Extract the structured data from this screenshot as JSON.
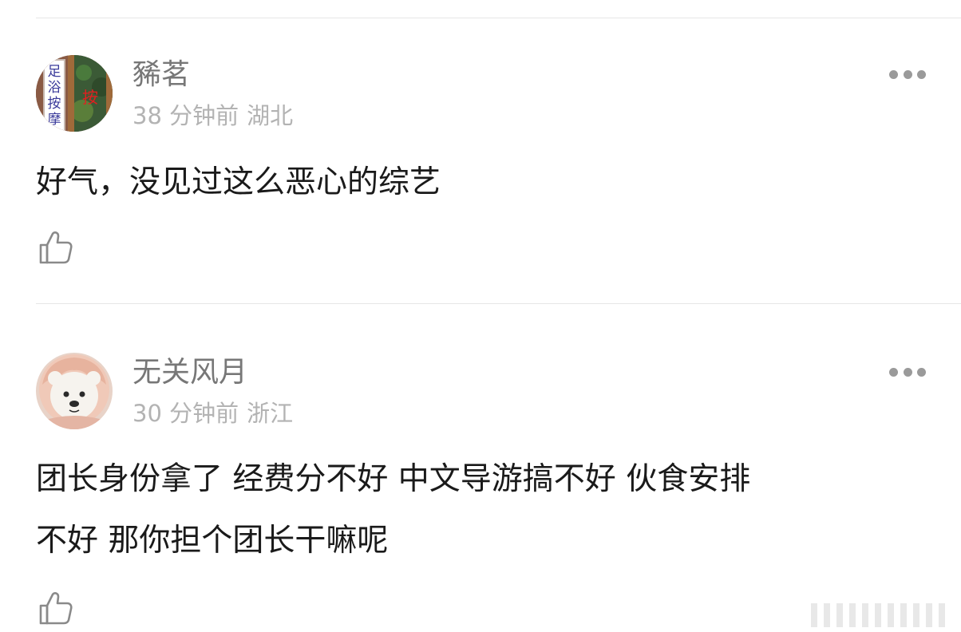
{
  "comments": [
    {
      "username": "豨茗",
      "time": "38 分钟前",
      "location": "湖北",
      "content": "好气，没见过这么恶心的综艺",
      "avatar_text": [
        "足",
        "浴",
        "按",
        "摩"
      ],
      "avatar_sign": "按"
    },
    {
      "username": "无关风月",
      "time": "30 分钟前",
      "location": "浙江",
      "content": "团长身份拿了 经费分不好 中文导游搞不好 伙食安排\n不好 那你担个团长干嘛呢",
      "avatar_desc_icon": "teddy-bear-icon"
    }
  ],
  "icons": {
    "more": "more-dots-icon",
    "like": "thumbs-up-icon"
  },
  "colors": {
    "username": "#777777",
    "meta": "#b3b3b3",
    "content": "#1a1a1a",
    "divider": "#e6e6e6"
  }
}
